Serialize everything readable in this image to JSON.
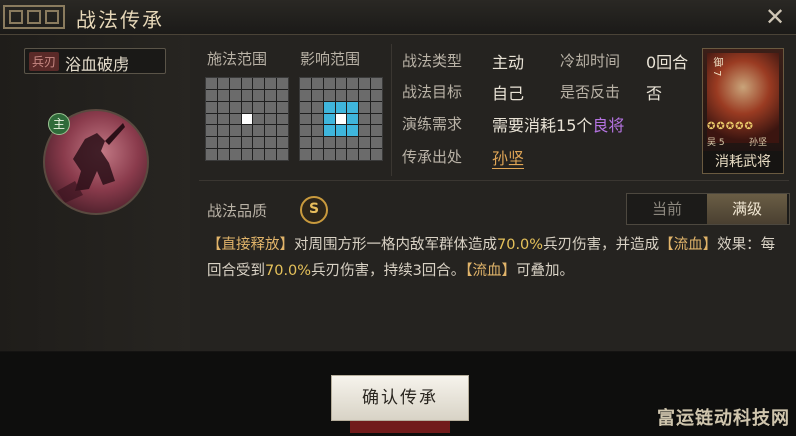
{
  "window": {
    "title": "战法传承",
    "close_icon": "close-icon"
  },
  "skill": {
    "type_tag": "兵刃",
    "name": "浴血破虏",
    "main_badge": "主"
  },
  "range": {
    "cast_label": "施法范围",
    "effect_label": "影响范围"
  },
  "info": {
    "type_label": "战法类型",
    "type_value": "主动",
    "cooldown_label": "冷却时间",
    "cooldown_value": "0回合",
    "target_label": "战法目标",
    "target_value": "自己",
    "counter_label": "是否反击",
    "counter_value": "否",
    "train_label": "演练需求",
    "train_prefix": "需要消耗",
    "train_count": "15",
    "train_unit": "个",
    "train_item": "良将",
    "source_label": "传承出处",
    "source_value": "孙坚"
  },
  "card": {
    "stars": "✪✪✪✪✪",
    "faction": "吴",
    "cost": "5",
    "name": "孙坚",
    "caption": "消耗武将",
    "side": "御 7"
  },
  "quality": {
    "label": "战法品质",
    "grade": "S"
  },
  "toggle": {
    "current": "当前",
    "max": "满级"
  },
  "description": {
    "tag1": "【直接释放】",
    "text1": "对周围方形一格内敌军群体造成",
    "pct1": "70.0%",
    "text2": "兵刃伤害，并造成",
    "tag2": "【流血】",
    "text3": "效果：每回合受到",
    "pct2": "70.0%",
    "text4": "兵刃伤害，持续3回合。",
    "tag3": "【流血】",
    "text5": "可叠加。"
  },
  "buttons": {
    "confirm": "确认传承"
  },
  "watermark": "富运链动科技网",
  "colors": {
    "accent_gold": "#e5c15a",
    "link_orange": "#e0a555",
    "purple": "#b473e0",
    "highlight_cyan": "#3fb6dd"
  }
}
